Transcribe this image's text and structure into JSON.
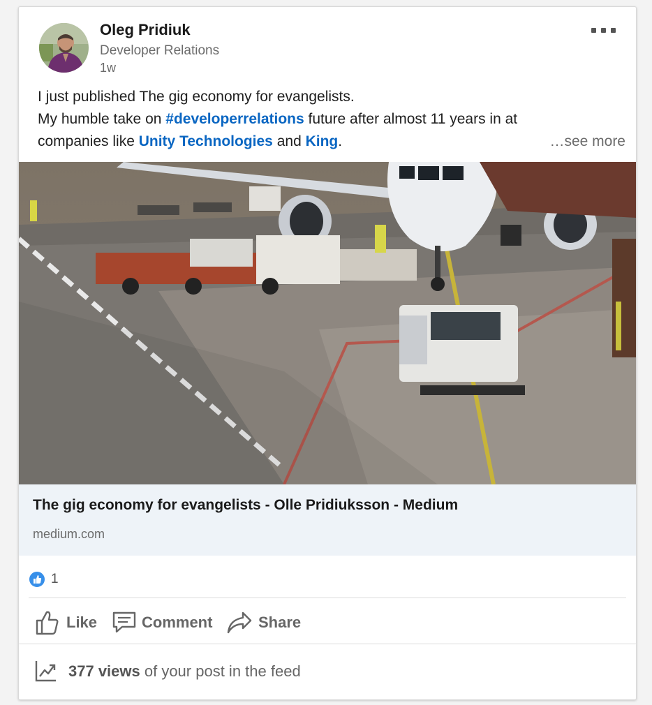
{
  "post": {
    "author": {
      "name": "Oleg Pridiuk",
      "headline": "Developer Relations",
      "time": "1w"
    },
    "text": {
      "line1": "I just published The gig economy for evangelists.",
      "line2_before": "My humble take on ",
      "hashtag": "#developerrelations",
      "line2_after": " future after almost 11 years in at",
      "line3_before": "companies like ",
      "mention1": "Unity Technologies",
      "line3_mid": " and ",
      "mention2": "King",
      "line3_after": ".",
      "see_more": "…see more"
    },
    "link": {
      "title": "The gig economy for evangelists - Olle Pridiuksson - Medium",
      "source": "medium.com"
    },
    "social": {
      "reaction_count": "1"
    },
    "actions": {
      "like": "Like",
      "comment": "Comment",
      "share": "Share"
    },
    "analytics": {
      "views": "377 views",
      "suffix": " of your post in the feed"
    }
  },
  "icons": {
    "more": "more-horizontal-icon",
    "like": "thumbs-up-icon",
    "comment": "comment-icon",
    "share": "share-arrow-icon",
    "analytics": "trending-chart-icon",
    "reaction": "like-reaction-icon"
  },
  "colors": {
    "link_blue": "#0a66c2",
    "reaction_blue": "#378fe9",
    "link_preview_bg": "#eef3f8",
    "secondary_text": "#666666"
  }
}
